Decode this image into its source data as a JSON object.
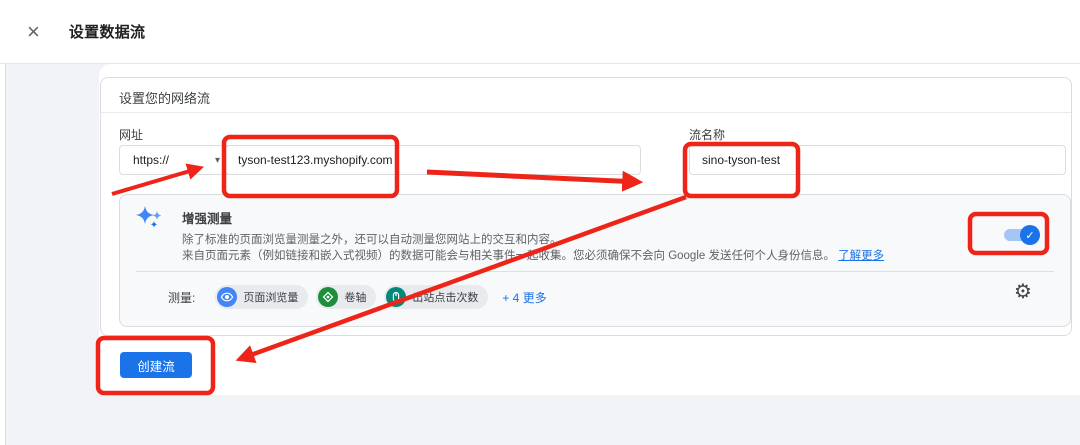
{
  "header": {
    "title": "设置数据流"
  },
  "panel": {
    "card_title": "设置您的网络流",
    "url": {
      "label": "网址",
      "protocol": "https://",
      "value": "tyson-test123.myshopify.com"
    },
    "stream_name": {
      "label": "流名称",
      "value": "sino-tyson-test"
    },
    "enhanced_measurement": {
      "title": "增强测量",
      "description_line1": "除了标准的页面浏览量测量之外，还可以自动测量您网站上的交互和内容。",
      "description_line2": "来自页面元素（例如链接和嵌入式视频）的数据可能会与相关事件一起收集。您必须确保不会向 Google 发送任何个人身份信息。",
      "learn_more_link": "了解更多",
      "toggle_state": "on",
      "measure_label": "测量:",
      "badges": [
        {
          "label": "页面浏览量",
          "icon": "eye-icon",
          "color": "#4285f4"
        },
        {
          "label": "卷轴",
          "icon": "scroll-icon",
          "color": "#1e8e3e"
        },
        {
          "label": "出站点击次数",
          "icon": "mouse-icon",
          "color": "#00897b"
        }
      ],
      "more_label": "+ 4 更多"
    },
    "create_button": "创建流"
  },
  "colors": {
    "accent_blue": "#1a73e8",
    "link_blue": "#1a73e8",
    "annotation_red": "#ee2418",
    "toggle_track": "#a5c5f7"
  }
}
